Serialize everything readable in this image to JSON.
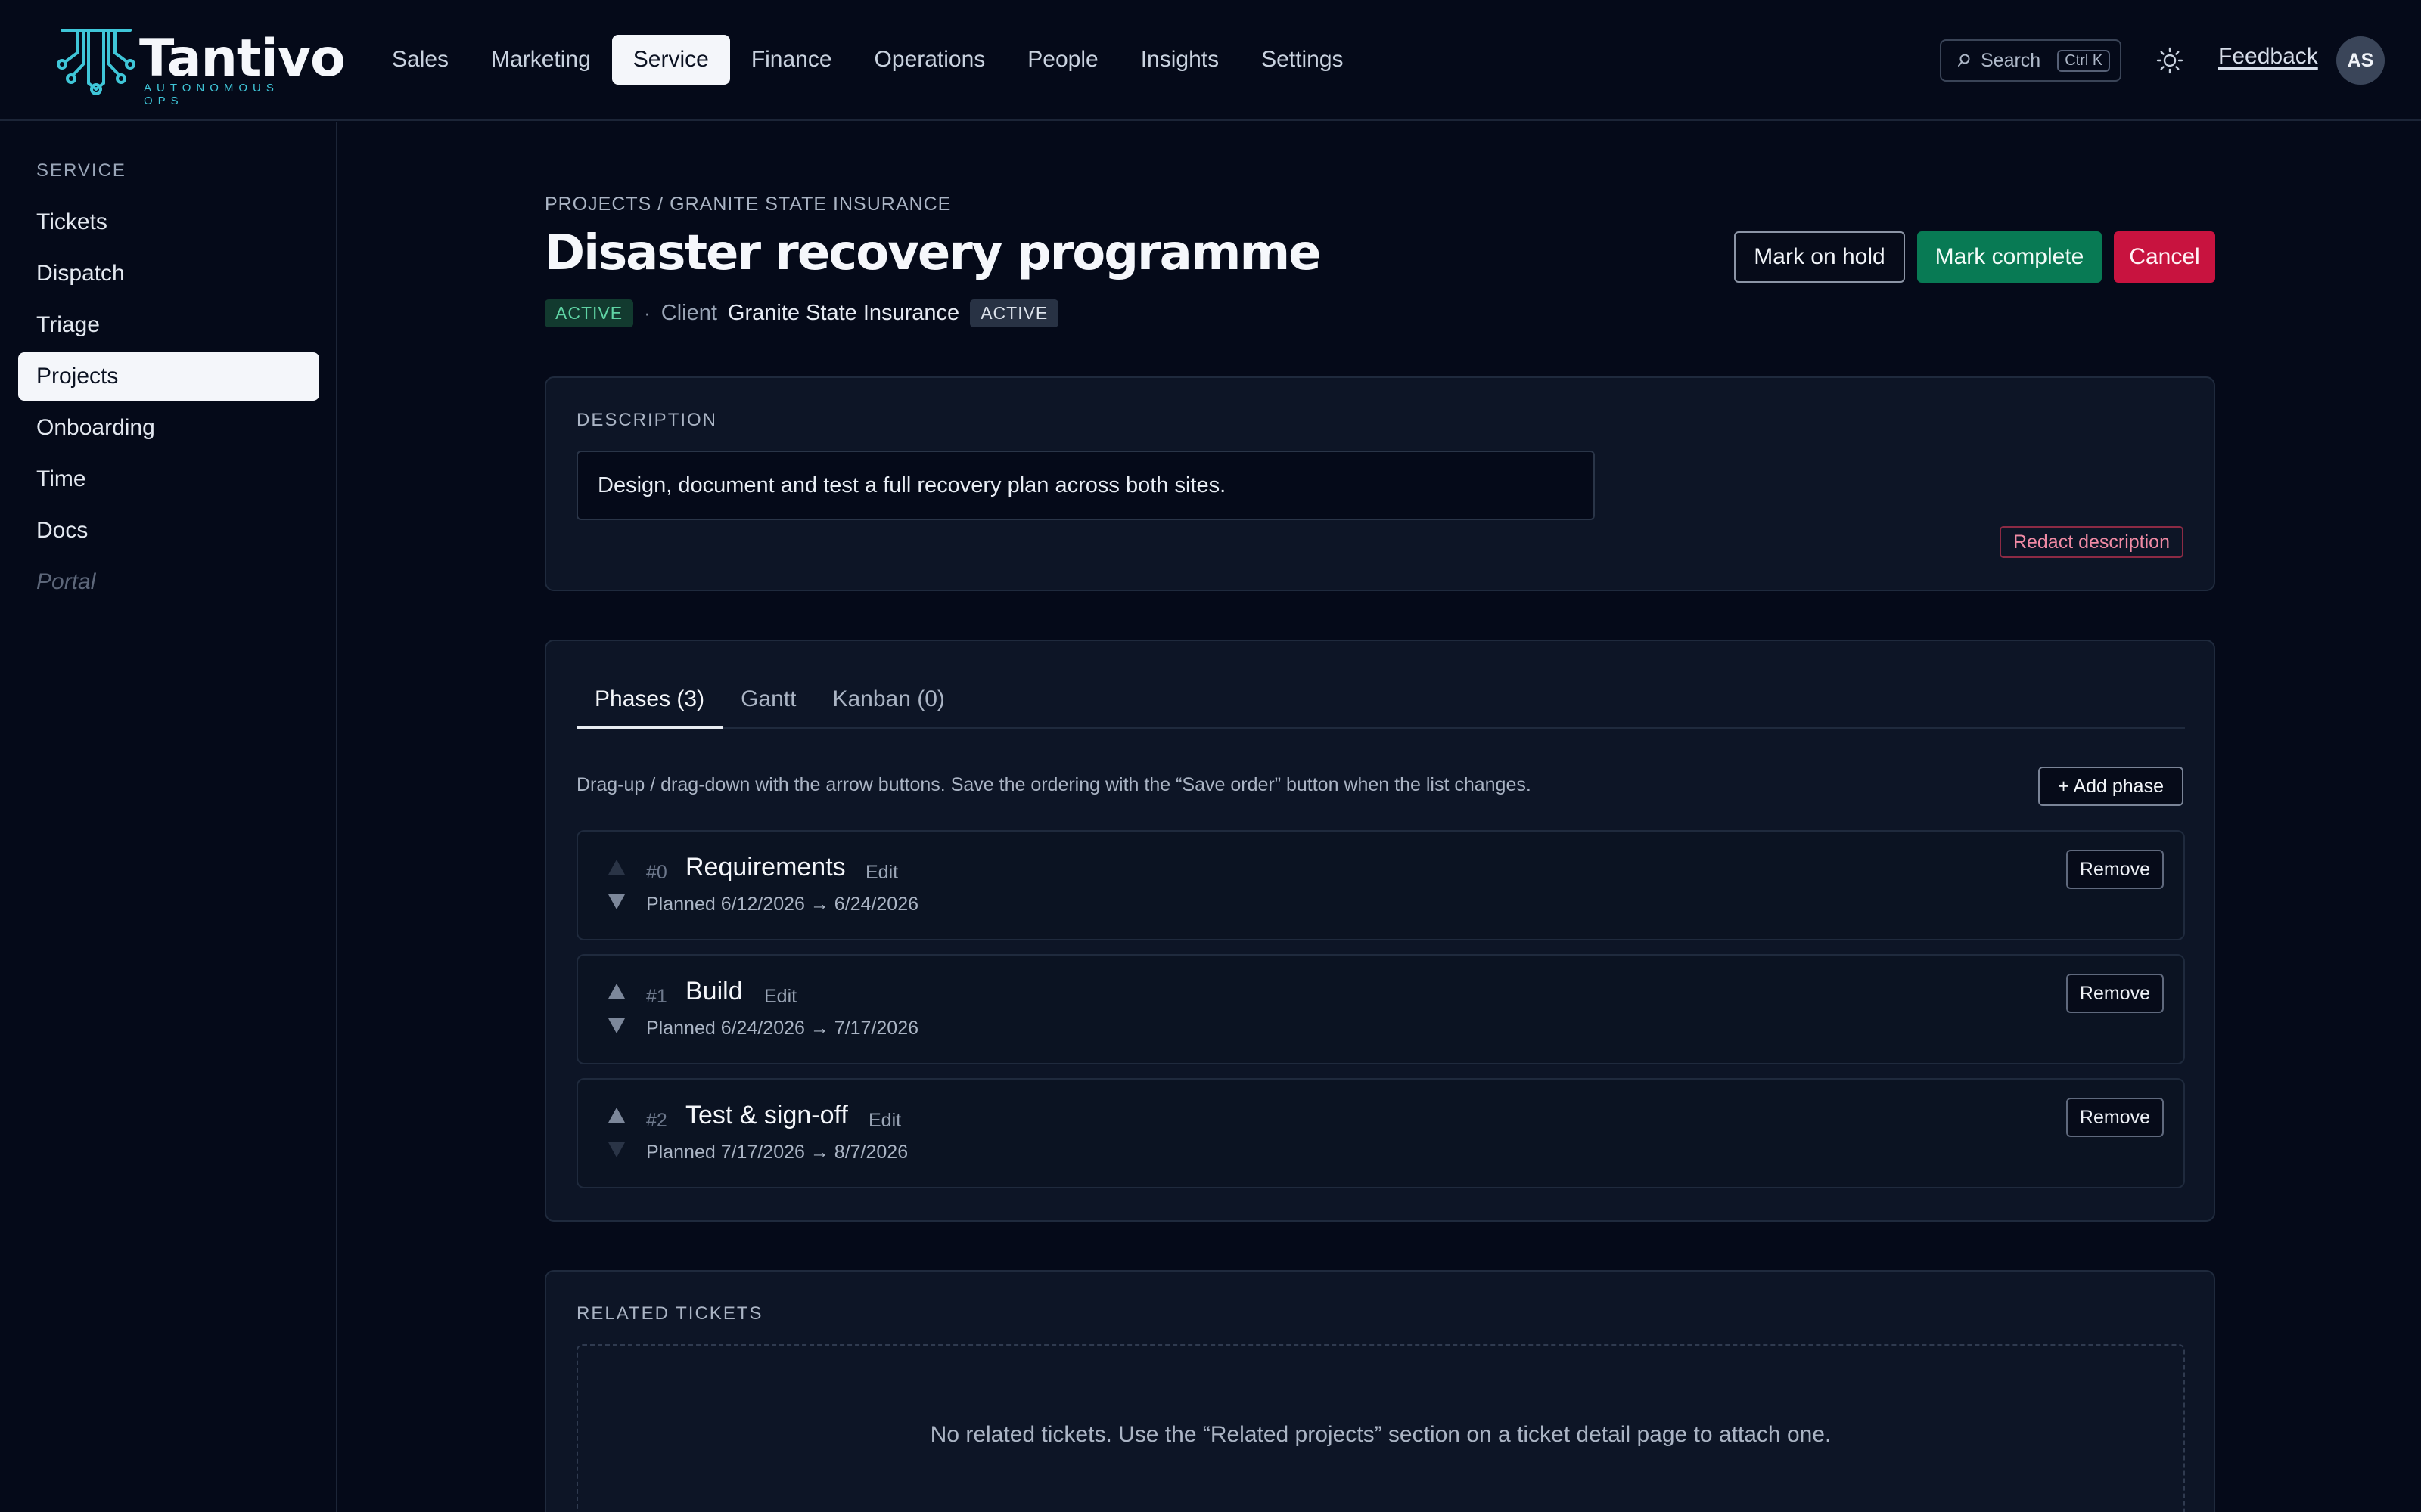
{
  "brand": {
    "name": "Tantivo",
    "tagline": "AUTONOMOUS OPS",
    "accent": "#3fc6d8"
  },
  "topnav": {
    "items": [
      "Sales",
      "Marketing",
      "Service",
      "Finance",
      "Operations",
      "People",
      "Insights",
      "Settings"
    ],
    "active": "Service",
    "search_label": "Search",
    "search_shortcut": "Ctrl K",
    "theme_icon": "sun-icon",
    "feedback_label": "Feedback",
    "avatar_initials": "AS"
  },
  "sidebar": {
    "heading": "SERVICE",
    "items": [
      {
        "label": "Tickets",
        "state": "normal"
      },
      {
        "label": "Dispatch",
        "state": "normal"
      },
      {
        "label": "Triage",
        "state": "normal"
      },
      {
        "label": "Projects",
        "state": "active"
      },
      {
        "label": "Onboarding",
        "state": "normal"
      },
      {
        "label": "Time",
        "state": "normal"
      },
      {
        "label": "Docs",
        "state": "normal"
      },
      {
        "label": "Portal",
        "state": "disabled"
      }
    ]
  },
  "project": {
    "breadcrumb": "PROJECTS / GRANITE STATE INSURANCE",
    "title": "Disaster recovery programme",
    "status_badge": "ACTIVE",
    "client_label": "Client",
    "client_name": "Granite State Insurance",
    "client_badge": "ACTIVE"
  },
  "actions": {
    "hold_label": "Mark on hold",
    "complete_label": "Mark complete",
    "cancel_label": "Cancel",
    "colors": {
      "complete": "#087a54",
      "cancel": "#c8133f"
    }
  },
  "description": {
    "label": "DESCRIPTION",
    "text": "Design, document and test a full recovery plan across both sites.",
    "redact_label": "Redact description"
  },
  "tabs": [
    {
      "label": "Phases (3)",
      "active": true
    },
    {
      "label": "Gantt",
      "active": false
    },
    {
      "label": "Kanban (0)",
      "active": false
    }
  ],
  "phases_panel": {
    "hint": "Drag-up / drag-down with the arrow buttons. Save the ordering with the “Save order” button when the list changes.",
    "add_label": "+ Add phase",
    "edit_label": "Edit",
    "remove_label": "Remove",
    "phases": [
      {
        "num": "#0",
        "name": "Requirements",
        "dates": "Planned 6/12/2026 → 6/24/2026",
        "up_enabled": false,
        "down_enabled": true
      },
      {
        "num": "#1",
        "name": "Build",
        "dates": "Planned 6/24/2026 → 7/17/2026",
        "up_enabled": true,
        "down_enabled": true
      },
      {
        "num": "#2",
        "name": "Test & sign-off",
        "dates": "Planned 7/17/2026 → 8/7/2026",
        "up_enabled": true,
        "down_enabled": false
      }
    ]
  },
  "related": {
    "label": "RELATED TICKETS",
    "empty_text": "No related tickets. Use the “Related projects” section on a ticket detail page to attach one."
  }
}
